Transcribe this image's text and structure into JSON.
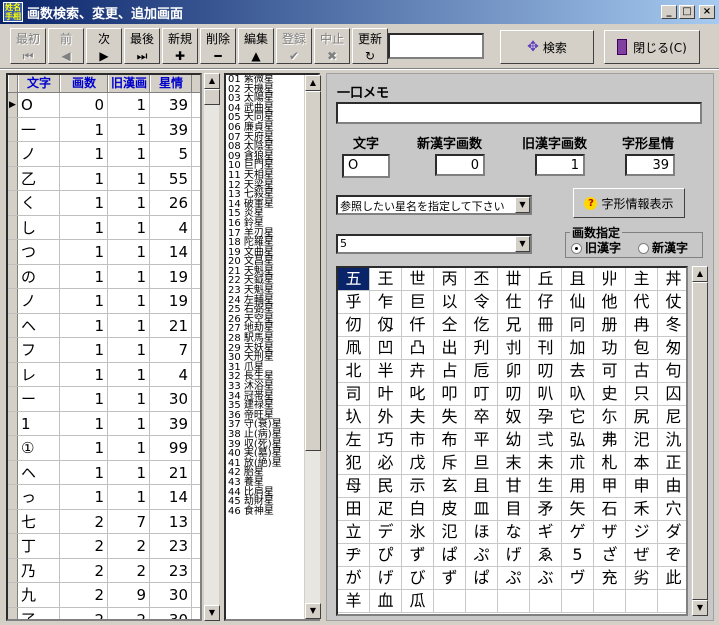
{
  "window": {
    "title": "画数検索、変更、追加画面",
    "icon_text_1": "姓名",
    "icon_text_2": "手相",
    "min": "_",
    "max": "□",
    "close": "×"
  },
  "toolbar": {
    "buttons": [
      {
        "label": "最初",
        "icon": "⏮",
        "enabled": false
      },
      {
        "label": "前",
        "icon": "◀",
        "enabled": false
      },
      {
        "label": "次",
        "icon": "▶",
        "enabled": true
      },
      {
        "label": "最後",
        "icon": "⏭",
        "enabled": true
      },
      {
        "label": "新規",
        "icon": "✚",
        "enabled": true
      },
      {
        "label": "削除",
        "icon": "━",
        "enabled": true
      },
      {
        "label": "編集",
        "icon": "▲",
        "enabled": true
      },
      {
        "label": "登録",
        "icon": "✔",
        "enabled": false
      },
      {
        "label": "中止",
        "icon": "✖",
        "enabled": false
      },
      {
        "label": "更新",
        "icon": "↻",
        "enabled": true
      }
    ],
    "search_value": "",
    "search_label": "検索",
    "close_label": "閉じる(C)"
  },
  "grid": {
    "headers": [
      "文字",
      "画数",
      "旧漢画",
      "星情"
    ],
    "rows": [
      [
        "O",
        "0",
        "1",
        "39"
      ],
      [
        "一",
        "1",
        "1",
        "39"
      ],
      [
        "ノ",
        "1",
        "1",
        "5"
      ],
      [
        "乙",
        "1",
        "1",
        "55"
      ],
      [
        "く",
        "1",
        "1",
        "26"
      ],
      [
        "し",
        "1",
        "1",
        "4"
      ],
      [
        "つ",
        "1",
        "1",
        "14"
      ],
      [
        "の",
        "1",
        "1",
        "19"
      ],
      [
        "ノ",
        "1",
        "1",
        "19"
      ],
      [
        "ヘ",
        "1",
        "1",
        "21"
      ],
      [
        "フ",
        "1",
        "1",
        "7"
      ],
      [
        "レ",
        "1",
        "1",
        "4"
      ],
      [
        "ー",
        "1",
        "1",
        "30"
      ],
      [
        "1",
        "1",
        "1",
        "39"
      ],
      [
        "①",
        "1",
        "1",
        "99"
      ],
      [
        "ヘ",
        "1",
        "1",
        "21"
      ],
      [
        "っ",
        "1",
        "1",
        "14"
      ],
      [
        "七",
        "2",
        "7",
        "13"
      ],
      [
        "丁",
        "2",
        "2",
        "23"
      ],
      [
        "乃",
        "2",
        "2",
        "23"
      ],
      [
        "九",
        "2",
        "9",
        "30"
      ],
      [
        "了",
        "2",
        "2",
        "30"
      ]
    ]
  },
  "stars": [
    "01 紫微星",
    "02 天機星",
    "03 太陽星",
    "04 武曲星",
    "05 天同星",
    "06 廉貞星",
    "07 天府星",
    "08 太陰星",
    "09 貪狼星",
    "10 巨門星",
    "11 天相星",
    "12 天梁星",
    "13 七殺星",
    "14 破軍星",
    "15 炎星",
    "16 鈴星",
    "17 羊刃星",
    "18 陀羅星",
    "19 文曲星",
    "20 文昌星",
    "21 天魁星",
    "22 天鉞星",
    "23 天魁星",
    "24 左輔星",
    "25 右弼星",
    "26 天空星",
    "27 地劫星",
    "28 駅馬星",
    "29 天妖星",
    "30 天刑星",
    "31 爪星",
    "32 長生星",
    "33 沐浴星",
    "34 冠帯星",
    "35 建禄星",
    "36 帝旺星",
    "37 守(衰)星",
    "38 止(病)星",
    "39 収(死)星",
    "40 実(墓)星",
    "41 放(絶)星",
    "42 胎星",
    "43 養星",
    "44 比肩星",
    "45 劫財星",
    "46 食神星"
  ],
  "memo": {
    "label": "一口メモ",
    "value": ""
  },
  "fields": {
    "char_label": "文字",
    "new_label": "新漢字画数",
    "old_label": "旧漢字画数",
    "star_label": "字形星情",
    "char_value": "O",
    "new_value": "0",
    "old_value": "1",
    "star_value": "39"
  },
  "star_select": {
    "value": "参照したい星名を指定して下さい"
  },
  "info_button": "字形情報表示",
  "stroke_select": {
    "value": "5"
  },
  "radio": {
    "title": "画数指定",
    "old": "旧漢字",
    "new": "新漢字"
  },
  "kanji": [
    "五",
    "王",
    "世",
    "丙",
    "丕",
    "丗",
    "丘",
    "且",
    "丱",
    "主",
    "丼",
    "乎",
    "乍",
    "巨",
    "以",
    "令",
    "仕",
    "仔",
    "仙",
    "他",
    "代",
    "仗",
    "仞",
    "仭",
    "仟",
    "仝",
    "仡",
    "兄",
    "冊",
    "冋",
    "册",
    "冉",
    "冬",
    "凧",
    "凹",
    "凸",
    "出",
    "刋",
    "刌",
    "刊",
    "加",
    "功",
    "包",
    "匆",
    "北",
    "半",
    "卉",
    "占",
    "卮",
    "卯",
    "叨",
    "去",
    "可",
    "古",
    "句",
    "司",
    "叶",
    "叱",
    "叩",
    "叮",
    "叨",
    "叭",
    "叺",
    "史",
    "只",
    "囚",
    "圦",
    "外",
    "夫",
    "失",
    "卒",
    "奴",
    "孕",
    "它",
    "尓",
    "尻",
    "尼",
    "左",
    "巧",
    "市",
    "布",
    "平",
    "幼",
    "弍",
    "弘",
    "弗",
    "汜",
    "氿",
    "犯",
    "必",
    "戊",
    "斥",
    "旦",
    "末",
    "未",
    "朮",
    "札",
    "本",
    "正",
    "母",
    "民",
    "示",
    "玄",
    "且",
    "甘",
    "生",
    "用",
    "甲",
    "申",
    "由",
    "田",
    "疋",
    "白",
    "皮",
    "皿",
    "目",
    "矛",
    "矢",
    "石",
    "禾",
    "穴",
    "立",
    "デ",
    "氷",
    "氾",
    "ほ",
    "な",
    "ギ",
    "ゲ",
    "ザ",
    "ジ",
    "ダ",
    "ヂ",
    "ぴ",
    "ず",
    "ぱ",
    "ぷ",
    "げ",
    "ゑ",
    "5",
    "ざ",
    "ぜ",
    "ぞ",
    "が",
    "げ",
    "び",
    "ず",
    "ぱ",
    "ぷ",
    "ぶ",
    "ヴ",
    "充",
    "劣",
    "此",
    "羊",
    "血",
    "瓜"
  ]
}
